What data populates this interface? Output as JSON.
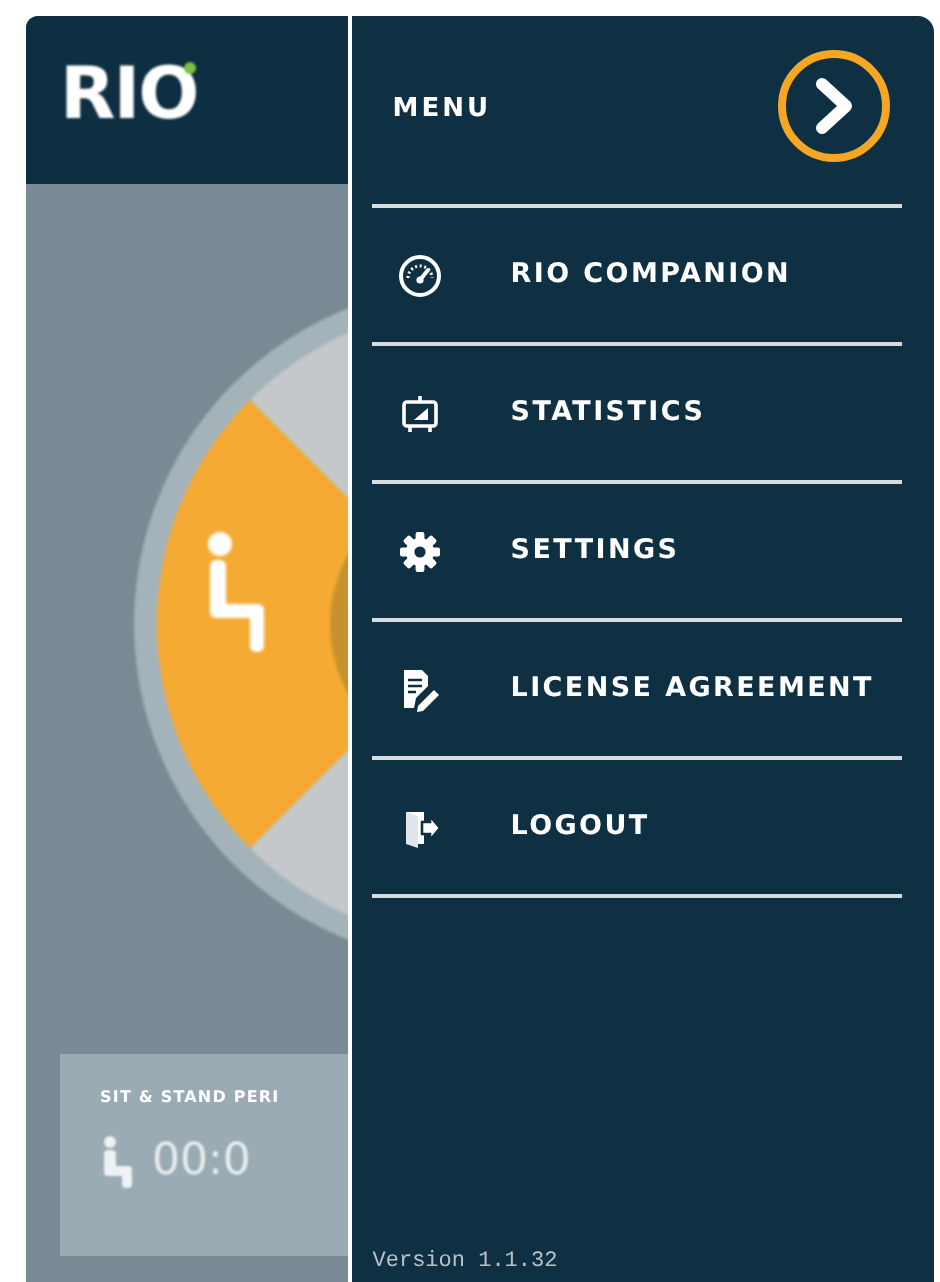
{
  "app": {
    "logo": "RIO",
    "card": {
      "label": "SIT & STAND PERI",
      "time": "00:0"
    }
  },
  "menu": {
    "title": "MENU",
    "items": [
      {
        "label": "RIO COMPANION",
        "kind": "gauge"
      },
      {
        "label": "STATISTICS",
        "kind": "monitor"
      },
      {
        "label": "SETTINGS",
        "kind": "gear"
      },
      {
        "label": "LICENSE AGREEMENT",
        "kind": "document"
      },
      {
        "label": "LOGOUT",
        "kind": "exit"
      }
    ],
    "version": "Version 1.1.32"
  }
}
